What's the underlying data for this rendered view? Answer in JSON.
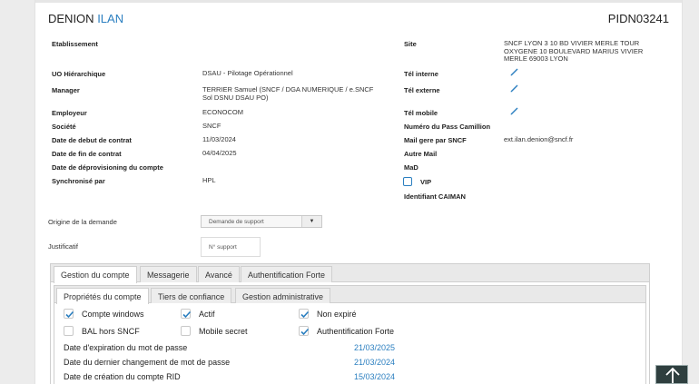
{
  "header": {
    "first_name": "DENION",
    "last_name": "ILAN",
    "pid": "PIDN03241"
  },
  "left": {
    "etablissement": {
      "label": "Etablissement",
      "value": ""
    },
    "uo": {
      "label": "UO Hiérarchique",
      "value": "DSAU - Pilotage Opérationnel"
    },
    "manager": {
      "label": "Manager",
      "value": "TERRIER Samuel (SNCF / DGA NUMERIQUE / e.SNCF Sol DSNU DSAU PO)"
    },
    "employeur": {
      "label": "Employeur",
      "value": "ECONOCOM"
    },
    "societe": {
      "label": "Société",
      "value": "SNCF"
    },
    "date_debut": {
      "label": "Date de debut de contrat",
      "value": "11/03/2024"
    },
    "date_fin": {
      "label": "Date de fin de contrat",
      "value": "04/04/2025"
    },
    "deprovisioning": {
      "label": "Date de déprovisioning du compte",
      "value": ""
    },
    "synchronise": {
      "label": "Synchronisé par",
      "value": "HPL"
    }
  },
  "right": {
    "site": {
      "label": "Site",
      "value": "SNCF LYON 3 10 BD VIVIER MERLE TOUR OXYGENE 10 BOULEVARD MARIUS VIVIER MERLE 69003 LYON"
    },
    "tel_interne": {
      "label": "Tél interne"
    },
    "tel_externe": {
      "label": "Tél externe"
    },
    "tel_mobile": {
      "label": "Tél mobile"
    },
    "pass_camillion": {
      "label": "Numéro du Pass Camillion"
    },
    "mail_sncf": {
      "label": "Mail gere par SNCF",
      "value": "ext.ilan.denion@sncf.fr"
    },
    "autre_mail": {
      "label": "Autre Mail"
    },
    "mad": {
      "label": "MaD"
    },
    "vip": {
      "label": "VIP"
    },
    "caiman": {
      "label": "Identifiant CAIMAN"
    }
  },
  "form": {
    "origine": {
      "label": "Origine de la demande",
      "selected": "Demande de support"
    },
    "justificatif": {
      "label": "Justificatif",
      "placeholder": "N° support"
    }
  },
  "tabs": [
    "Gestion du compte",
    "Messagerie",
    "Avancé",
    "Authentification Forte"
  ],
  "subtabs": [
    "Propriétés du compte",
    "Tiers de confiance",
    "Gestion administrative"
  ],
  "checkboxes": [
    {
      "label": "Compte windows",
      "checked": true
    },
    {
      "label": "Actif",
      "checked": true
    },
    {
      "label": "Non expiré",
      "checked": true
    },
    {
      "label": "BAL hors SNCF",
      "checked": false
    },
    {
      "label": "Mobile secret",
      "checked": false
    },
    {
      "label": "Authentification Forte",
      "checked": true
    }
  ],
  "password_rows": [
    {
      "label": "Date d'expiration du mot de passe",
      "value": "21/03/2025"
    },
    {
      "label": "Date du dernier changement de mot de passe",
      "value": "21/03/2024"
    },
    {
      "label": "Date de création du compte RID",
      "value": "15/03/2024"
    }
  ],
  "colors": {
    "accent": "#2b7fc0",
    "scroll_button": "#2f3f3f"
  },
  "icons": {
    "edit": "pencil-icon",
    "scroll_top": "arrow-up-icon",
    "dropdown": "caret-down-icon"
  }
}
